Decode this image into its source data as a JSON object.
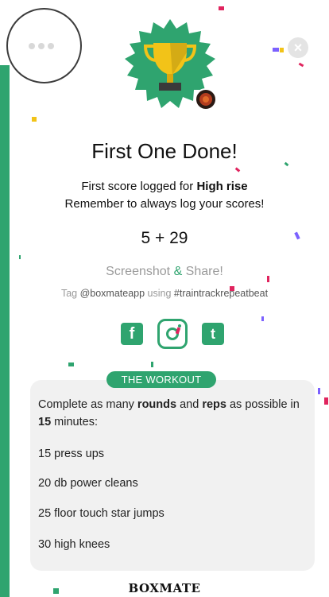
{
  "colors": {
    "accent": "#2fa46f",
    "muted": "#9a9a9a"
  },
  "header": {
    "menu_icon": "more-dots-icon",
    "close_icon": "close-icon",
    "close_glyph": "×"
  },
  "badge": {
    "icon": "trophy-icon",
    "logo_icon": "club-logo-icon"
  },
  "title": "First One Done!",
  "subtitle": {
    "line1_prefix": "First score logged for ",
    "workout_name": "High rise",
    "line2": "Remember to always log your scores!"
  },
  "score": "5 + 29",
  "share": {
    "label_prefix": "Screenshot ",
    "label_amp": "&",
    "label_suffix": " Share!",
    "tag_prefix": "Tag ",
    "handle": "@boxmateapp",
    "tag_mid": " using ",
    "hashtag": "#traintrackrepeatbeat"
  },
  "socials": [
    {
      "name": "facebook",
      "icon": "facebook-icon",
      "glyph": "f"
    },
    {
      "name": "instagram",
      "icon": "instagram-icon",
      "glyph": ""
    },
    {
      "name": "twitter",
      "icon": "twitter-icon",
      "glyph": "t"
    }
  ],
  "workout": {
    "pill": "THE WORKOUT",
    "desc_1": "Complete as many ",
    "desc_bold1": "rounds",
    "desc_2": " and ",
    "desc_bold2": "reps",
    "desc_3": " as possible in ",
    "desc_bold3": "15",
    "desc_4": " minutes:",
    "items": [
      "15 press ups",
      "20 db power cleans",
      "25 floor touch star jumps",
      "30 high knees"
    ]
  },
  "footer": {
    "brand": "BOXMATE"
  }
}
